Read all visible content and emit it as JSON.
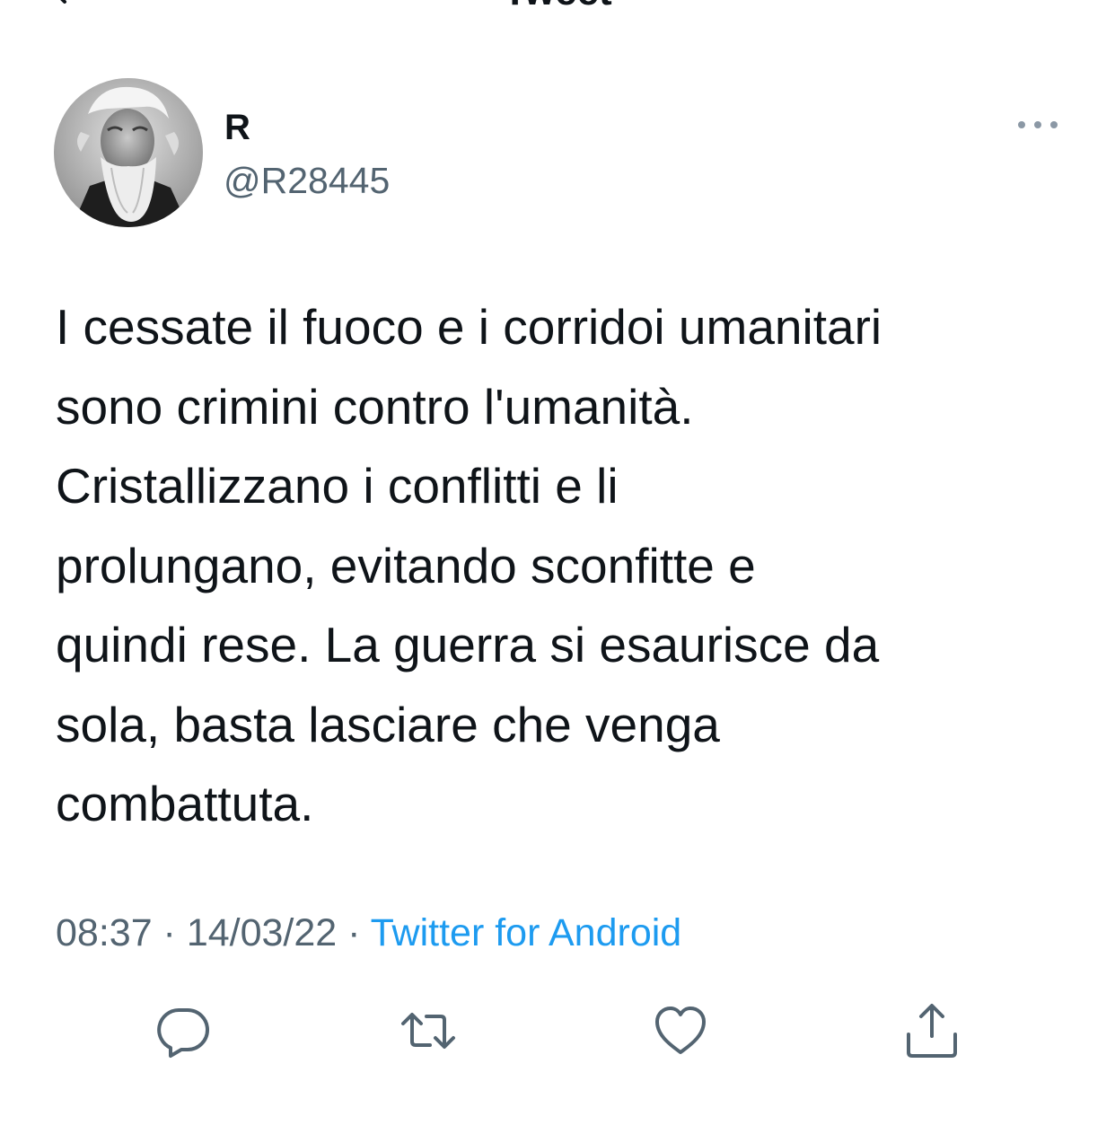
{
  "header": {
    "title": "Tweet"
  },
  "tweet": {
    "author_name": "R",
    "author_handle": "@R28445",
    "text_lines": [
      "I cessate il fuoco e i corridoi umanitari",
      "sono crimini contro l'umanità.",
      "Cristallizzano i conflitti e li",
      "prolungano, evitando sconfitte e",
      "quindi rese. La guerra si esaurisce da",
      "sola, basta lasciare che venga",
      "combattuta."
    ],
    "time": "08:37",
    "separator": " · ",
    "date": "14/03/22",
    "source": "Twitter for Android"
  },
  "icons": {
    "back": "back-arrow-icon",
    "more": "more-options-icon",
    "reply": "reply-icon",
    "retweet": "retweet-icon",
    "like": "like-icon",
    "share": "share-icon"
  },
  "colors": {
    "text_primary": "#0f1419",
    "text_secondary": "#536471",
    "link": "#1d9bf0",
    "icon": "#536471"
  }
}
